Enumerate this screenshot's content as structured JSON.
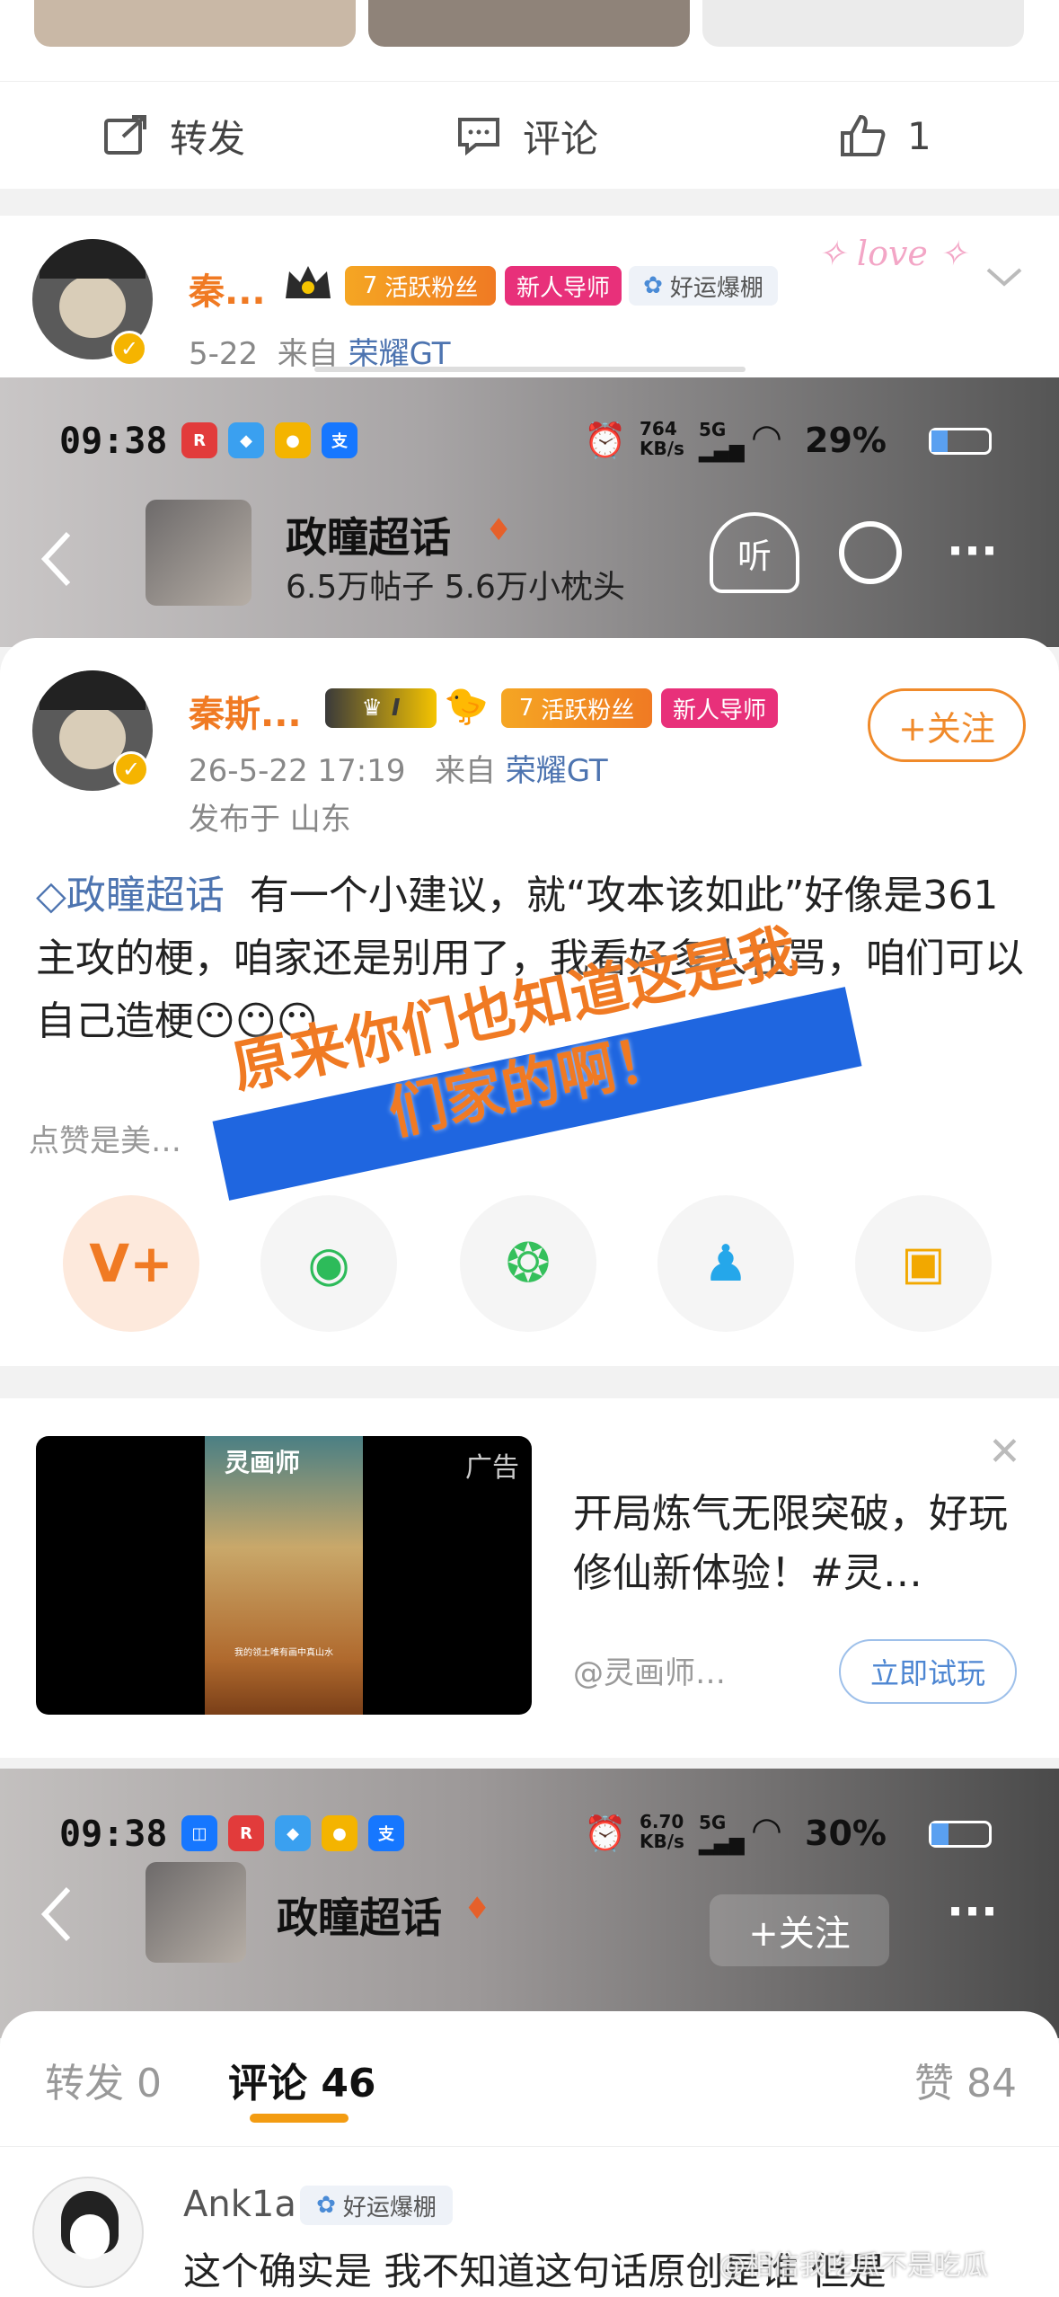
{
  "top_actions": {
    "repost": "转发",
    "comment": "评论",
    "like_count": "1"
  },
  "post1": {
    "username": "秦...",
    "badges": {
      "level": "7",
      "fan": "活跃粉丝",
      "mentor": "新人导师",
      "luck": "好运爆棚"
    },
    "date": "5-22",
    "from_label": "来自",
    "device": "荣耀GT"
  },
  "shot1": {
    "status": {
      "time": "09:38",
      "net_speed": "764",
      "net_unit": "KB/s",
      "signal": "5G",
      "battery": "29%"
    },
    "header": {
      "title": "政瞳超话",
      "stats": "6.5万帖子 5.6万小枕头",
      "listen_label": "听"
    },
    "post": {
      "username": "秦斯...",
      "rank": "I",
      "level": "7",
      "fan_badge": "活跃粉丝",
      "mentor_badge": "新人导师",
      "follow": "+关注",
      "datetime": "26-5-22 17:19",
      "from_label": "来自",
      "device": "荣耀GT",
      "location": "发布于 山东",
      "topic": "政瞳超话",
      "text": "有一个小建议，就“攻本该如此”好像是361主攻的梗，咱家还是别用了，我看好多人在骂，咱们可以自己造梗",
      "emojis": "😶😶😶",
      "like_hint": "点赞是美…           …鼓励"
    },
    "overlay_text": {
      "line1": "原来你们也知道这是我",
      "line2": "们家的啊！"
    }
  },
  "ad": {
    "game_title": "灵画师",
    "tag": "广告",
    "text": "开局炼气无限突破，好玩修仙新体验！#灵…",
    "source": "@灵画师…",
    "cta": "立即试玩",
    "video_caption": "我的领土唯有画中真山水"
  },
  "shot2": {
    "status": {
      "time": "09:38",
      "net_speed": "6.70",
      "net_unit": "KB/s",
      "signal": "5G",
      "battery": "30%"
    },
    "header": {
      "title": "政瞳超话",
      "follow": "+关注"
    },
    "tabs": {
      "repost": "转发 0",
      "comment": "评论 46",
      "likes": "赞 84"
    },
    "comment": {
      "username": "Ank1a",
      "badge": "好运爆棚",
      "text": "这个确实是 我不知道这句话原创是谁 但是"
    }
  },
  "watermark": "@相信我吃瓜不是吃瓜",
  "colors": {
    "orange": "#f07a23",
    "link_blue": "#4d74b0",
    "overlay_orange": "#f07a23",
    "overlay_blue": "#1f66e0"
  }
}
